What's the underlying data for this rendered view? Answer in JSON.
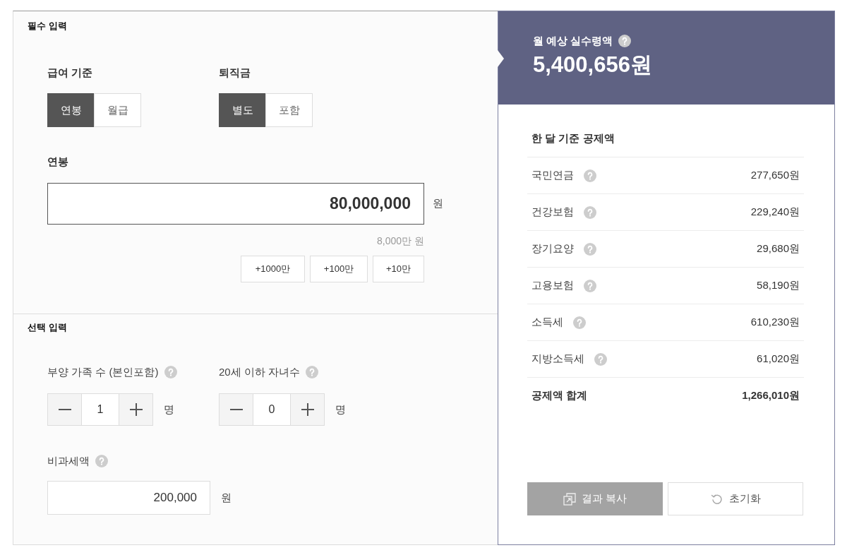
{
  "required_input": {
    "title": "필수 입력",
    "salary_basis": {
      "label": "급여 기준",
      "options": [
        {
          "label": "연봉",
          "selected": true
        },
        {
          "label": "월급",
          "selected": false
        }
      ]
    },
    "severance": {
      "label": "퇴직금",
      "options": [
        {
          "label": "별도",
          "selected": true
        },
        {
          "label": "포함",
          "selected": false
        }
      ]
    },
    "salary": {
      "label": "연봉",
      "value": "80,000,000",
      "unit": "원",
      "hint": "8,000만 원",
      "quick_add": [
        "+1000만",
        "+100만",
        "+10만"
      ]
    }
  },
  "optional_input": {
    "title": "선택 입력",
    "counters": [
      {
        "label": "부양 가족 수 (본인포함)",
        "value": "1",
        "unit": "명"
      },
      {
        "label": "20세 이하 자녀수",
        "value": "0",
        "unit": "명"
      }
    ],
    "tax_free": {
      "label": "비과세액",
      "value": "200,000",
      "unit": "원"
    }
  },
  "result": {
    "title": "월 예상 실수령액",
    "amount": "5,400,656원",
    "deductions_title": "한 달 기준 공제액",
    "deductions": [
      {
        "label": "국민연금",
        "value": "277,650원"
      },
      {
        "label": "건강보험",
        "value": "229,240원"
      },
      {
        "label": "장기요양",
        "value": "29,680원"
      },
      {
        "label": "고용보험",
        "value": "58,190원"
      },
      {
        "label": "소득세",
        "value": "610,230원"
      },
      {
        "label": "지방소득세",
        "value": "61,020원"
      }
    ],
    "total": {
      "label": "공제액 합계",
      "value": "1,266,010원"
    },
    "buttons": [
      {
        "label": "결과 복사",
        "kind": "copy"
      },
      {
        "label": "초기화",
        "kind": "reset"
      }
    ]
  }
}
